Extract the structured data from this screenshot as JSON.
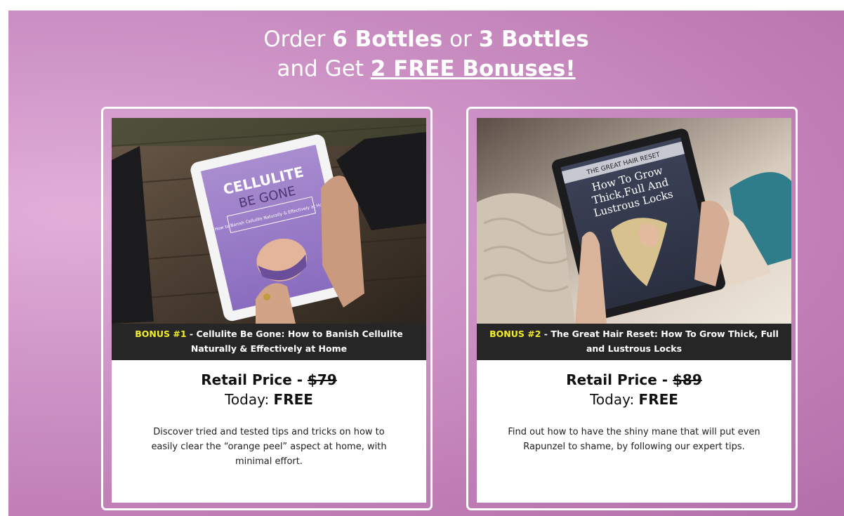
{
  "headline": {
    "line1_pre": "Order ",
    "line1_six": "6 Bottles",
    "line1_or": " or ",
    "line1_three": "3 Bottles",
    "line2_pre": "and Get ",
    "line2_bonus": "2 FREE Bonuses!"
  },
  "cards": [
    {
      "tag": "BONUS #1",
      "title": " - Cellulite Be Gone: How to Banish Cellulite Naturally & Effectively at Home",
      "price_label": "Retail Price - ",
      "price": "$79",
      "today_label": "Today: ",
      "today_value": "FREE",
      "description": "Discover tried and tested tips and tricks on how to easily clear the “orange peel” aspect at home, with minimal effort.",
      "ebook": {
        "title1": "CELLULITE",
        "title2": "BE GONE",
        "subtitle": "How to Banish Cellulite Naturally & Effectively at Home"
      }
    },
    {
      "tag": "BONUS #2",
      "title": " - The Great Hair Reset: How To Grow Thick, Full and Lustrous Locks",
      "price_label": "Retail Price - ",
      "price": "$89",
      "today_label": "Today: ",
      "today_value": "FREE",
      "description": "Find out how to have the shiny mane that will put even Rapunzel to shame, by following our expert tips.",
      "ebook": {
        "banner": "THE GREAT HAIR RESET",
        "title1": "How To Grow",
        "title2": "Thick,Full And",
        "title3": "Lustrous Locks"
      }
    }
  ]
}
